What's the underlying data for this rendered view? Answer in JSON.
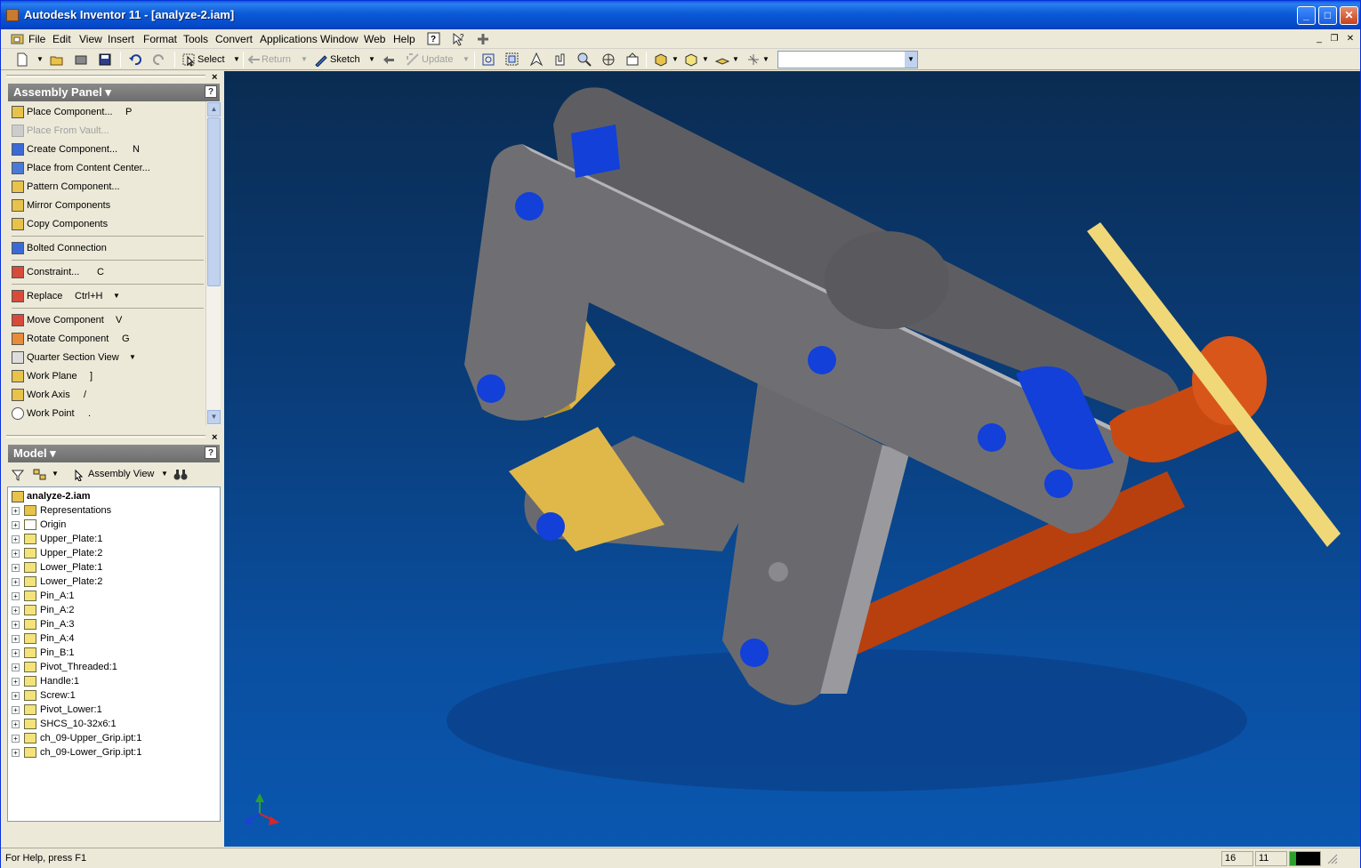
{
  "window": {
    "title": "Autodesk Inventor 11 - [analyze-2.iam]"
  },
  "menu": [
    "File",
    "Edit",
    "View",
    "Insert",
    "Format",
    "Tools",
    "Convert",
    "Applications",
    "Window",
    "Web",
    "Help"
  ],
  "toolbar": {
    "select_label": "Select",
    "return_label": "Return",
    "sketch_label": "Sketch",
    "update_label": "Update",
    "combo_value": ""
  },
  "assembly_panel": {
    "title": "Assembly Panel",
    "items": [
      {
        "label": "Place Component...",
        "key": "P",
        "disabled": false
      },
      {
        "label": "Place From Vault...",
        "key": "",
        "disabled": true
      },
      {
        "label": "Create Component...",
        "key": "N",
        "disabled": false
      },
      {
        "label": "Place from Content Center...",
        "key": "",
        "disabled": false
      },
      {
        "label": "Pattern Component...",
        "key": "",
        "disabled": false
      },
      {
        "label": "Mirror Components",
        "key": "",
        "disabled": false
      },
      {
        "label": "Copy Components",
        "key": "",
        "disabled": false
      },
      {
        "label": "Bolted Connection",
        "key": "",
        "disabled": false
      },
      {
        "label": "Constraint...",
        "key": "C",
        "disabled": false
      },
      {
        "label": "Replace",
        "key": "Ctrl+H",
        "disabled": false
      },
      {
        "label": "Move Component",
        "key": "V",
        "disabled": false
      },
      {
        "label": "Rotate Component",
        "key": "G",
        "disabled": false
      },
      {
        "label": "Quarter Section View",
        "key": "",
        "disabled": false
      },
      {
        "label": "Work Plane",
        "key": "]",
        "disabled": false
      },
      {
        "label": "Work Axis",
        "key": "/",
        "disabled": false
      },
      {
        "label": "Work Point",
        "key": ".",
        "disabled": false
      }
    ]
  },
  "model_panel": {
    "title": "Model",
    "view_label": "Assembly View",
    "root": "analyze-2.iam",
    "nodes": [
      "Representations",
      "Origin",
      "Upper_Plate:1",
      "Upper_Plate:2",
      "Lower_Plate:1",
      "Lower_Plate:2",
      "Pin_A:1",
      "Pin_A:2",
      "Pin_A:3",
      "Pin_A:4",
      "Pin_B:1",
      "Pivot_Threaded:1",
      "Handle:1",
      "Screw:1",
      "Pivot_Lower:1",
      "SHCS_10-32x6:1",
      "ch_09-Upper_Grip.ipt:1",
      "ch_09-Lower_Grip.ipt:1"
    ]
  },
  "status": {
    "help_text": "For Help, press F1",
    "count_a": "16",
    "count_b": "11"
  },
  "colors": {
    "viewport_bg": "#0a3c78",
    "plate_gray": "#6f6f73",
    "pin_blue": "#1240d8",
    "grip_yellow": "#e0b84a",
    "screw_orange": "#c84a10",
    "handle_yellow": "#f0d878"
  }
}
